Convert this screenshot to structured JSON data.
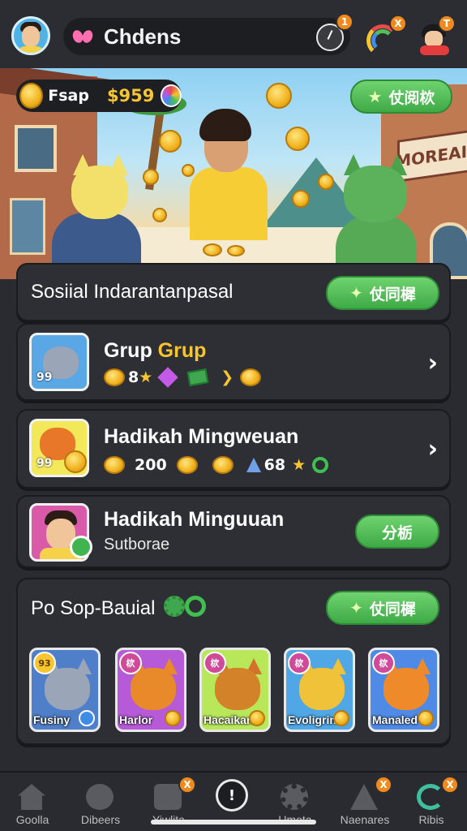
{
  "topbar": {
    "title": "Chdens",
    "timer_badge": "1",
    "rainbow_badge": "X",
    "profile_badge": "T"
  },
  "scene": {
    "currency_chip": {
      "name": "Fsap",
      "value": "$959"
    },
    "top_button": "仗阅栨",
    "shop_sign": "MOREAIL"
  },
  "header_panel": {
    "title": "Sosiial Indarantanpasal",
    "button": "仗同樨"
  },
  "rows": [
    {
      "name_a": "Grup",
      "name_b": "Grup",
      "thumb_num": "99",
      "stat_a": "8"
    },
    {
      "name": "Hadikah Mingweuan",
      "thumb_num": "99",
      "stat_a": "200",
      "stat_b": "68"
    },
    {
      "name": "Hadikah Minguuan",
      "subtitle": "Sutborae",
      "button": "分栃"
    }
  ],
  "pets_panel": {
    "title": "Po Sop-Bauial",
    "button": "仗同樨",
    "tag_first": "93",
    "pets": [
      {
        "label": "Fusiny",
        "tag": "93"
      },
      {
        "label": "Harlor",
        "tag": "栨"
      },
      {
        "label": "Hacaikan",
        "tag": "栨"
      },
      {
        "label": "Evoligrin",
        "tag": "栨"
      },
      {
        "label": "Manaled",
        "tag": "栨"
      }
    ]
  },
  "tabbar": {
    "tabs": [
      {
        "label": "Goolla"
      },
      {
        "label": "Dibeers"
      },
      {
        "label": "Yiwlita",
        "badge": "X"
      },
      {
        "label": "",
        "center_glyph": "!"
      },
      {
        "label": "Umota"
      },
      {
        "label": "Naenares",
        "badge": "X"
      },
      {
        "label": "Ribis",
        "badge": "X"
      }
    ]
  },
  "colors": {
    "accent_green": "#3eaa46",
    "gold": "#f6c531",
    "panel": "#2e2f35"
  }
}
